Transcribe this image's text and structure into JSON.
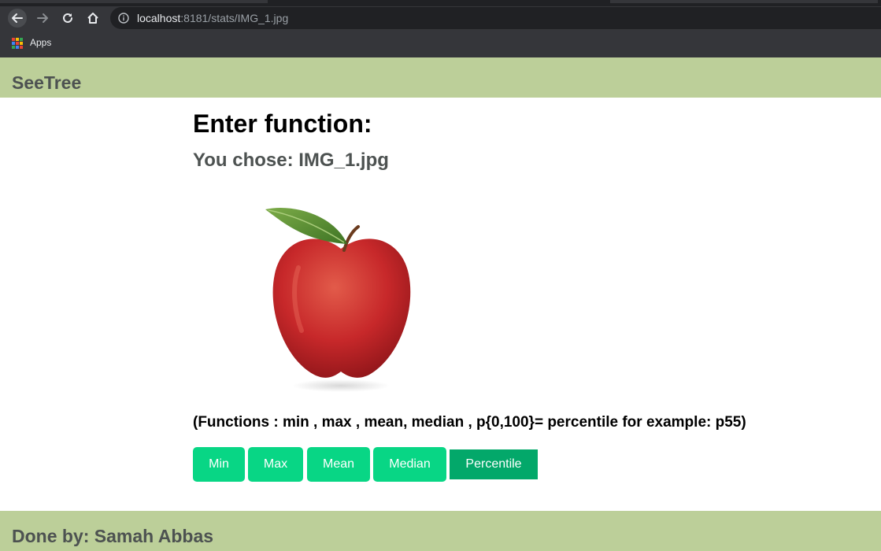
{
  "browser": {
    "url_host": "localhost",
    "url_rest": ":8181/stats/IMG_1.jpg",
    "bookmarks": [
      {
        "label": "Apps",
        "icon": "apps-grid-icon"
      }
    ],
    "icons": [
      "back-arrow-icon",
      "forward-arrow-icon",
      "reload-icon",
      "home-icon",
      "info-icon"
    ]
  },
  "header": {
    "brand": "SeeTree"
  },
  "main": {
    "heading": "Enter function:",
    "chosen": "You chose: IMG_1.jpg",
    "image": "red apple with leaf",
    "hint": "(Functions : min , max , mean, median , p{0,100}= percentile for example: p55)",
    "buttons": {
      "min": "Min",
      "max": "Max",
      "mean": "Mean",
      "median": "Median",
      "percentile": "Percentile"
    }
  },
  "footer": {
    "credit": "Done by: Samah Abbas"
  },
  "colors": {
    "band": "#bccf99",
    "button": "#08d685",
    "button_active": "#03a86a",
    "heading_grey": "#4d5251"
  }
}
